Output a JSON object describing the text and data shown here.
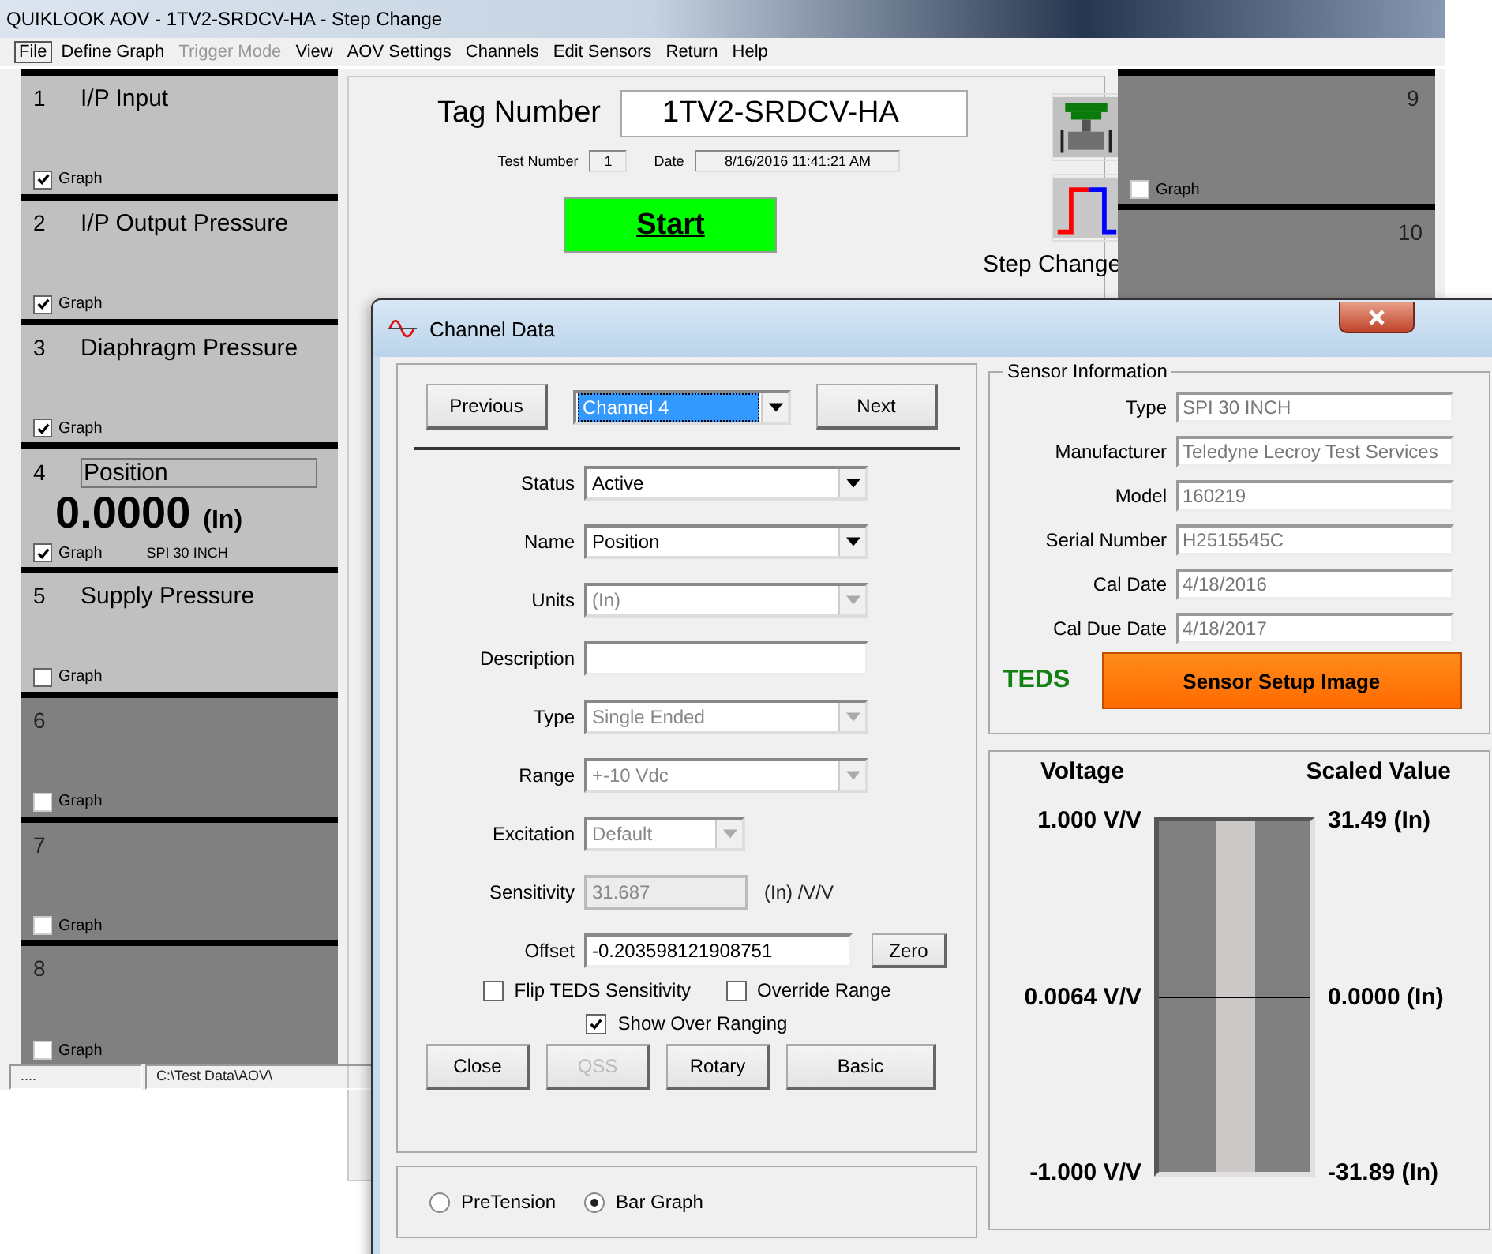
{
  "window": {
    "title": "QUIKLOOK AOV - 1TV2-SRDCV-HA - Step Change"
  },
  "menu": [
    {
      "label": "File",
      "selected": true,
      "disabled": false
    },
    {
      "label": "Define Graph",
      "selected": false,
      "disabled": false
    },
    {
      "label": "Trigger Mode",
      "selected": false,
      "disabled": true
    },
    {
      "label": "View",
      "selected": false,
      "disabled": false
    },
    {
      "label": "AOV Settings",
      "selected": false,
      "disabled": false
    },
    {
      "label": "Channels",
      "selected": false,
      "disabled": false
    },
    {
      "label": "Edit Sensors",
      "selected": false,
      "disabled": false
    },
    {
      "label": "Return",
      "selected": false,
      "disabled": false
    },
    {
      "label": "Help",
      "selected": false,
      "disabled": false
    }
  ],
  "channels_left": [
    {
      "kind": "named",
      "number": "1",
      "name": "I/P Input",
      "graph_label": "Graph",
      "graph_checked": true
    },
    {
      "kind": "named",
      "number": "2",
      "name": "I/P Output Pressure",
      "graph_label": "Graph",
      "graph_checked": true
    },
    {
      "kind": "named",
      "number": "3",
      "name": "Diaphragm Pressure",
      "graph_label": "Graph",
      "graph_checked": true
    },
    {
      "kind": "live",
      "number": "4",
      "name": "Position",
      "value": "0.0000",
      "unit": "(In)",
      "sensor": "SPI 30 INCH",
      "graph_label": "Graph",
      "graph_checked": true
    },
    {
      "kind": "named",
      "number": "5",
      "name": "Supply Pressure",
      "graph_label": "Graph",
      "graph_checked": false
    },
    {
      "kind": "empty",
      "number": "6",
      "graph_label": "Graph",
      "graph_checked": false
    },
    {
      "kind": "empty",
      "number": "7",
      "graph_label": "Graph",
      "graph_checked": false
    },
    {
      "kind": "empty",
      "number": "8",
      "graph_label": "Graph",
      "graph_checked": false
    }
  ],
  "header": {
    "tag_label": "Tag Number",
    "tag_value": "1TV2-SRDCV-HA",
    "test_number_label": "Test Number",
    "test_number": "1",
    "date_label": "Date",
    "date": "8/16/2016 11:41:21 AM",
    "start_button": "Start",
    "mode_label": "Step Change"
  },
  "channels_right": [
    {
      "kind": "empty",
      "number": "9",
      "graph_label": "Graph",
      "graph_checked": false
    },
    {
      "kind": "empty",
      "number": "10"
    }
  ],
  "status_bar": [
    "....",
    "C:\\Test Data\\AOV\\"
  ],
  "dialog": {
    "title": "Channel Data",
    "previous": "Previous",
    "channel_select": "Channel 4",
    "next": "Next",
    "fields": [
      {
        "kind": "dropdown",
        "label": "Status",
        "value": "Active",
        "disabled": false
      },
      {
        "kind": "dropdown",
        "label": "Name",
        "value": "Position",
        "disabled": false
      },
      {
        "kind": "dropdown",
        "label": "Units",
        "value": "(In)",
        "disabled": true
      },
      {
        "kind": "text",
        "label": "Description",
        "disabled": false
      },
      {
        "kind": "dropdown",
        "label": "Type",
        "value": "Single Ended",
        "disabled": true
      },
      {
        "kind": "dropdown",
        "label": "Range",
        "value": "+-10 Vdc",
        "disabled": true
      },
      {
        "kind": "small-dropdown",
        "label": "Excitation",
        "value": "Default",
        "disabled": true
      },
      {
        "kind": "unit-text",
        "label": "Sensitivity",
        "value": "31.687",
        "suffix": "(In) /V/V",
        "disabled": true
      },
      {
        "kind": "button-text",
        "label": "Offset",
        "value": "-0.203598121908751",
        "button": "Zero",
        "disabled": false
      }
    ],
    "checkboxes": [
      {
        "label": "Flip TEDS Sensitivity",
        "checked": false
      },
      {
        "label": "Override Range",
        "checked": false
      },
      {
        "label": "Show Over Ranging",
        "checked": true
      }
    ],
    "buttons": [
      {
        "label": "Close",
        "disabled": false
      },
      {
        "label": "QSS",
        "disabled": true
      },
      {
        "label": "Rotary",
        "disabled": false
      },
      {
        "label": "Basic",
        "disabled": false
      }
    ],
    "view_options": [
      {
        "label": "PreTension",
        "selected": false
      },
      {
        "label": "Bar Graph",
        "selected": true
      }
    ],
    "sensor_info": {
      "title": "Sensor Information",
      "fields": [
        {
          "label": "Type",
          "value": "SPI 30 INCH"
        },
        {
          "label": "Manufacturer",
          "value": "Teledyne Lecroy Test Services"
        },
        {
          "label": "Model",
          "value": "160219"
        },
        {
          "label": "Serial Number",
          "value": "H2515545C"
        },
        {
          "label": "Cal Date",
          "value": "4/18/2016"
        },
        {
          "label": "Cal Due Date",
          "value": "4/18/2017"
        }
      ],
      "teds": "TEDS",
      "setup_button": "Sensor Setup Image"
    },
    "bar_graph": {
      "left_title": "Voltage",
      "right_title": "Scaled Value",
      "left_labels": [
        "1.000 V/V",
        "0.0064 V/V",
        "-1.000 V/V"
      ],
      "right_labels": [
        "31.49 (In)",
        "0.0000 (In)",
        "-31.89 (In)"
      ]
    }
  }
}
